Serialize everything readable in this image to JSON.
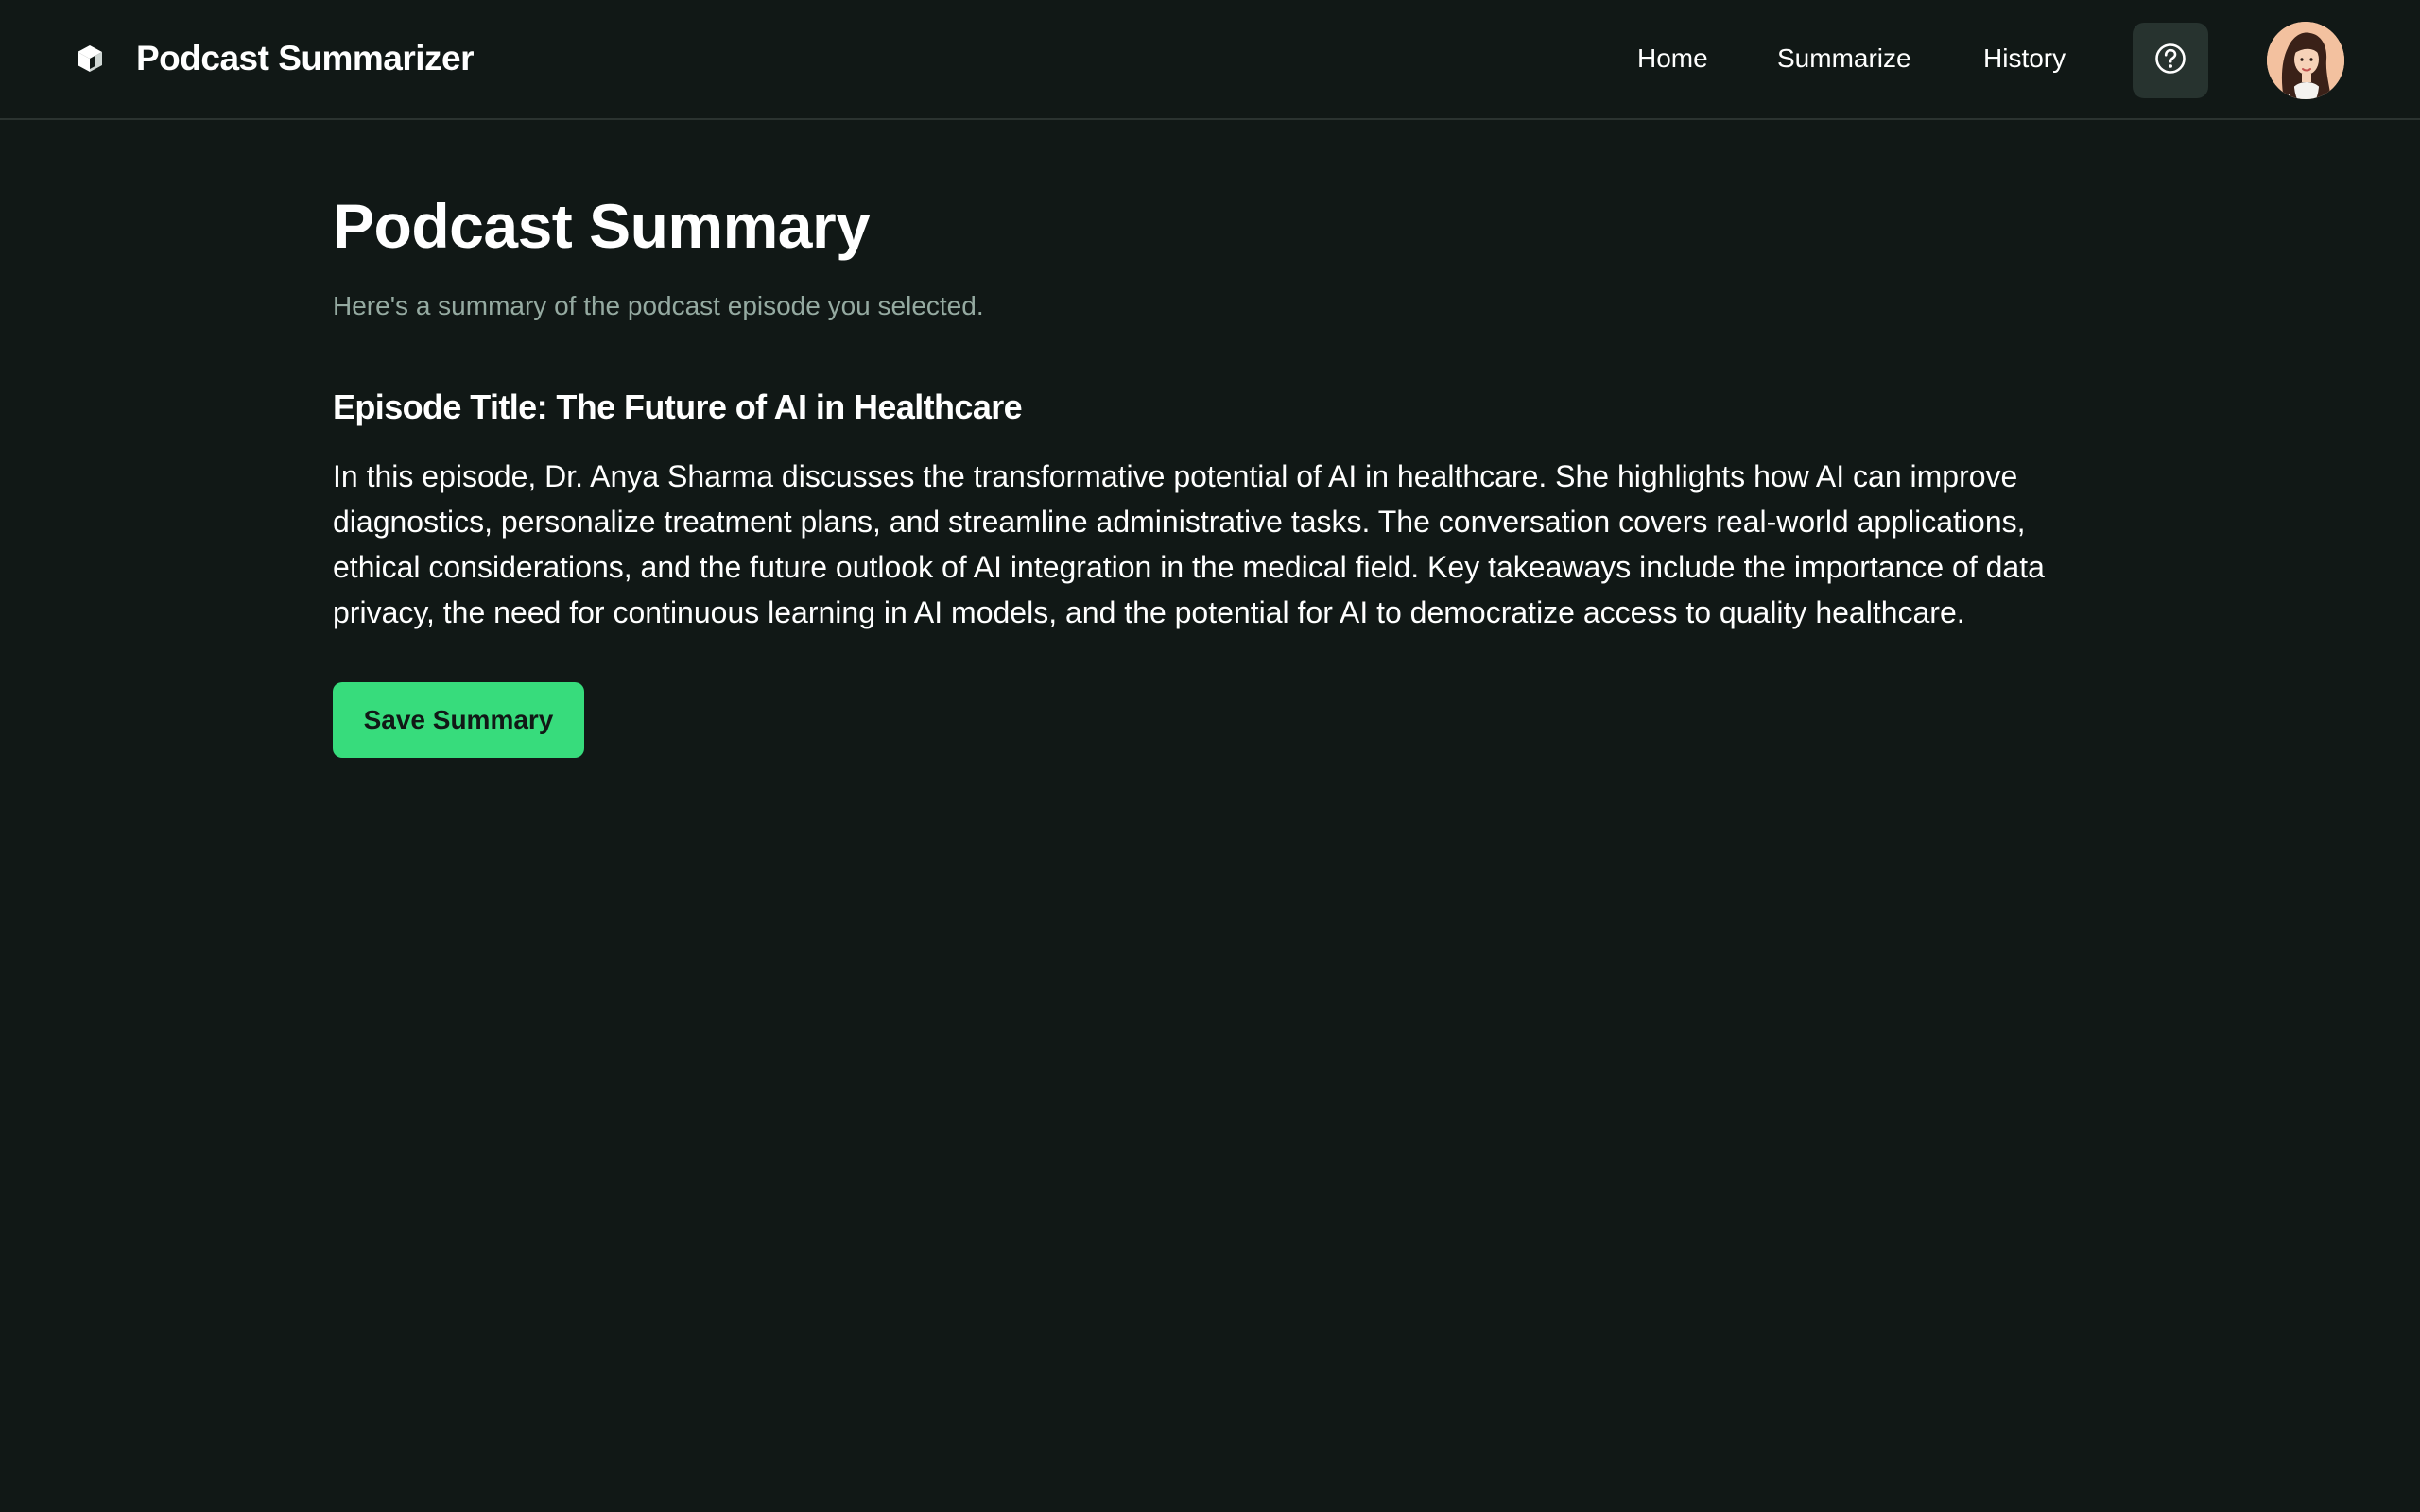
{
  "app": {
    "title": "Podcast Summarizer",
    "logo_icon": "cube-icon"
  },
  "nav": {
    "items": [
      {
        "label": "Home"
      },
      {
        "label": "Summarize"
      },
      {
        "label": "History"
      }
    ],
    "help_icon": "help-circle-icon",
    "avatar_icon": "user-avatar"
  },
  "main": {
    "title": "Podcast Summary",
    "subtitle": "Here's a summary of the podcast episode you selected.",
    "episode_title": "Episode Title: The Future of AI in Healthcare",
    "summary": "In this episode, Dr. Anya Sharma discusses the transformative potential of AI in healthcare. She highlights how AI can improve diagnostics, personalize treatment plans, and streamline administrative tasks. The conversation covers real-world applications, ethical considerations, and the future outlook of AI integration in the medical field. Key takeaways include the importance of data privacy, the need for continuous learning in AI models, and the potential for AI to democratize access to quality healthcare.",
    "save_button_label": "Save Summary"
  },
  "colors": {
    "background": "#111816",
    "accent": "#37dc7c",
    "muted_text": "#95aaa1",
    "help_button_bg": "#27332f"
  }
}
